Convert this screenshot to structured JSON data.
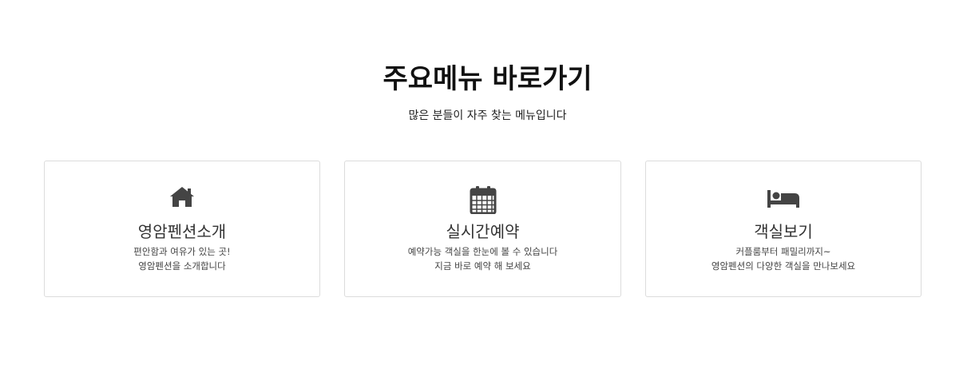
{
  "section": {
    "title": "주요메뉴 바로가기",
    "subtitle": "많은 분들이 자주 찾는 메뉴입니다"
  },
  "cards": [
    {
      "icon": "home-icon",
      "title": "영암펜션소개",
      "lines": [
        "편안함과 여유가 있는 곳!",
        "영암펜션을 소개합니다"
      ]
    },
    {
      "icon": "calendar-icon",
      "title": "실시간예약",
      "lines": [
        "예약가능 객실을 한눈에 볼 수 있습니다",
        "지금 바로 예약 해 보세요"
      ]
    },
    {
      "icon": "bed-icon",
      "title": "객실보기",
      "lines": [
        "커플룸부터 패밀리까지~",
        "영암펜션의 다양한 객실을 만나보세요"
      ]
    }
  ],
  "colors": {
    "icon": "#444444",
    "card_border": "#dcdcdc"
  }
}
